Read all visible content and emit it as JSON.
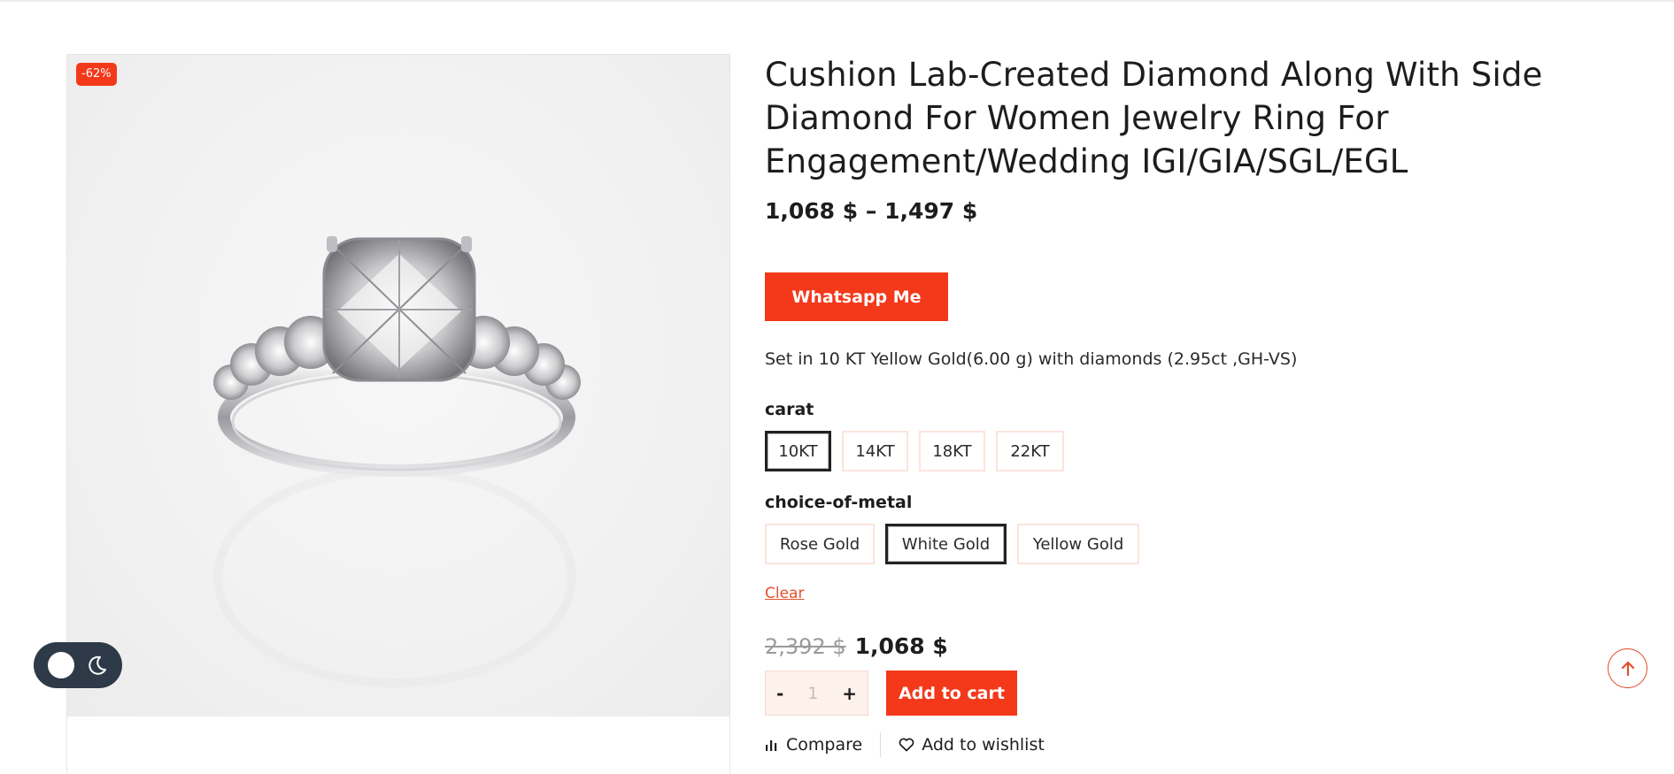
{
  "product": {
    "badge": "-62%",
    "title": "Cushion Lab-Created Diamond Along With Side Diamond For Women Jewelry Ring For Engagement/Wedding IGI/GIA/SGL/EGL",
    "price_range": "1,068 $ – 1,497 $",
    "whatsapp_label": "Whatsapp Me",
    "description": "Set in 10 KT Yellow Gold(6.00 g) with diamonds (2.95ct ,GH-VS)"
  },
  "options": {
    "carat": {
      "label": "carat",
      "values": [
        "10KT",
        "14KT",
        "18KT",
        "22KT"
      ],
      "selected": "10KT"
    },
    "metal": {
      "label": "choice-of-metal",
      "values": [
        "Rose Gold",
        "White Gold",
        "Yellow Gold"
      ],
      "selected": "White Gold"
    },
    "clear_label": "Clear"
  },
  "pricing": {
    "old": "2,392 $",
    "current": "1,068 $"
  },
  "cart": {
    "minus": "-",
    "quantity": "1",
    "plus": "+",
    "add_label": "Add to cart"
  },
  "links": {
    "compare": "Compare",
    "wishlist": "Add to wishlist"
  },
  "icons": {
    "theme_toggle": "moon-icon",
    "scroll_top": "arrow-up-icon",
    "compare": "bar-chart-icon",
    "wishlist": "heart-icon"
  },
  "colors": {
    "accent": "#f3391a",
    "toggle_bg": "#2e3a48"
  }
}
